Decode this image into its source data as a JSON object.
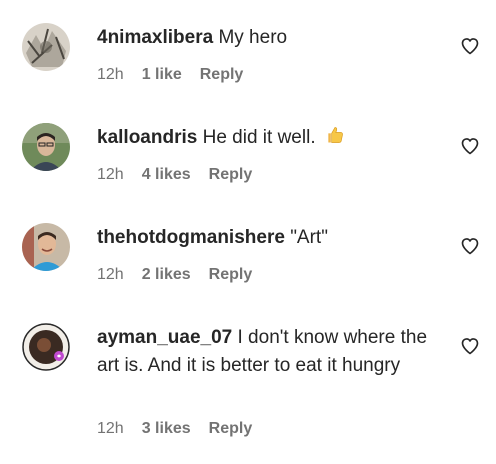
{
  "comments": [
    {
      "username": "4nimaxlibera",
      "text": "My hero",
      "time": "12h",
      "likes": "1 like",
      "reply": "Reply"
    },
    {
      "username": "kalloandris",
      "text": "He did it well.",
      "emoji": "thumbs-up-emoji",
      "time": "12h",
      "likes": "4 likes",
      "reply": "Reply"
    },
    {
      "username": "thehotdogmanishere",
      "text": "\"Art\"",
      "time": "12h",
      "likes": "2 likes",
      "reply": "Reply"
    },
    {
      "username": "ayman_uae_07",
      "text": "I don't know where the art is. And it is better to eat it hungry",
      "time": "12h",
      "likes": "3 likes",
      "reply": "Reply"
    }
  ],
  "icons": {
    "like": "heart-outline-icon"
  },
  "colors": {
    "primary_text": "#262626",
    "secondary_text": "#737373",
    "background": "#ffffff"
  }
}
